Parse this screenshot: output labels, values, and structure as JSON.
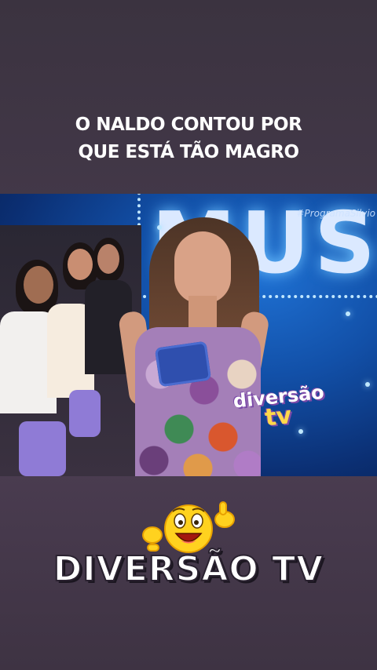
{
  "post": {
    "headline_line1": "O NALDO CONTOU POR",
    "headline_line2": "QUE ESTÁ TÃO MAGRO"
  },
  "video": {
    "hashtag": "#ProgramaSilvio",
    "stage_sign": "MUSICA",
    "watermark_line1": "diversão",
    "watermark_line2": "tv"
  },
  "branding": {
    "channel_name": "DIVERSÃO TV",
    "emoji": "laughing-emoji"
  },
  "colors": {
    "background": "#463a4c",
    "headline": "#ffffff",
    "stage_blue": "#1250a8",
    "watermark_accent": "#ffd84a"
  }
}
